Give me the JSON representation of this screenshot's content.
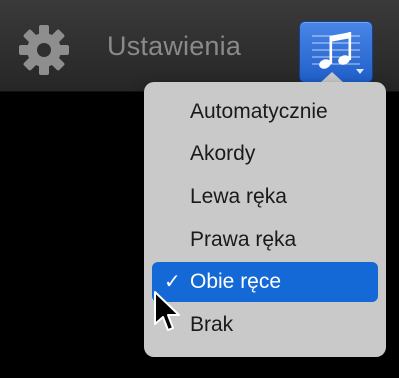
{
  "toolbar": {
    "settings_icon": "gear-icon",
    "title": "Ustawienia",
    "music_button_icon": "music-notes-icon"
  },
  "menu": {
    "items": [
      {
        "label": "Automatycznie",
        "checked": false,
        "selected": false
      },
      {
        "label": "Akordy",
        "checked": false,
        "selected": false
      },
      {
        "label": "Lewa ręka",
        "checked": false,
        "selected": false
      },
      {
        "label": "Prawa ręka",
        "checked": false,
        "selected": false
      },
      {
        "label": "Obie ręce",
        "checked": true,
        "selected": true
      },
      {
        "label": "Brak",
        "checked": false,
        "selected": false
      }
    ],
    "check_mark": "✓"
  },
  "colors": {
    "selection": "#1469d6",
    "menu_background": "#c9c9c9",
    "toolbar_text": "#8a8a8a",
    "button_accent": "#3b78dc"
  }
}
